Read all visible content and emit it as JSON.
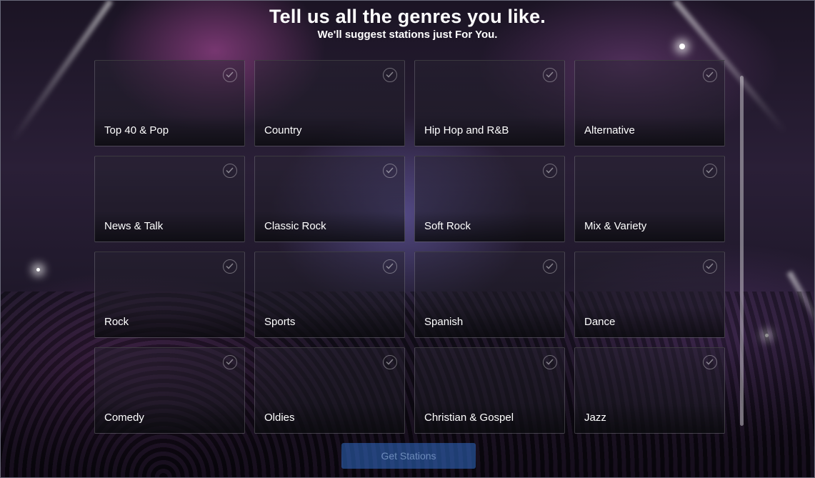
{
  "header": {
    "title": "Tell us all the genres you like.",
    "subtitle": "We'll suggest stations just For You."
  },
  "genres": [
    {
      "label": "Top 40 & Pop",
      "selected": false
    },
    {
      "label": "Country",
      "selected": false
    },
    {
      "label": "Hip Hop and R&B",
      "selected": false
    },
    {
      "label": "Alternative",
      "selected": false
    },
    {
      "label": "News & Talk",
      "selected": false
    },
    {
      "label": "Classic Rock",
      "selected": false
    },
    {
      "label": "Soft Rock",
      "selected": false
    },
    {
      "label": "Mix & Variety",
      "selected": false
    },
    {
      "label": "Rock",
      "selected": false
    },
    {
      "label": "Sports",
      "selected": false
    },
    {
      "label": "Spanish",
      "selected": false
    },
    {
      "label": "Dance",
      "selected": false
    },
    {
      "label": "Comedy",
      "selected": false
    },
    {
      "label": "Oldies",
      "selected": false
    },
    {
      "label": "Christian & Gospel",
      "selected": false
    },
    {
      "label": "Jazz",
      "selected": false
    }
  ],
  "cta": {
    "label": "Get Stations",
    "enabled": false
  },
  "icons": {
    "tile_check": "check-circle-icon"
  },
  "colors": {
    "cta": "#326ec8",
    "text": "#ffffff"
  }
}
